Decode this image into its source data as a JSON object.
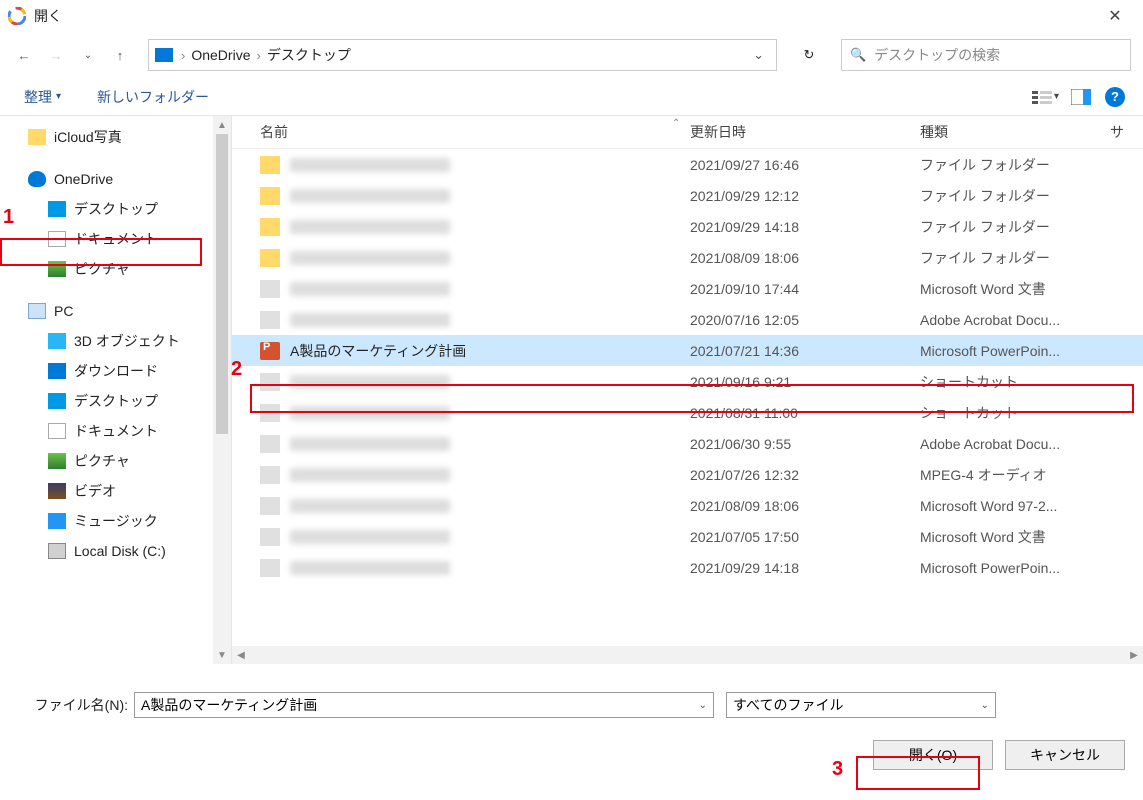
{
  "window": {
    "title": "開く"
  },
  "nav": {
    "breadcrumb": [
      "OneDrive",
      "デスクトップ"
    ]
  },
  "search": {
    "placeholder": "デスクトップの検索"
  },
  "toolbar": {
    "organize": "整理",
    "new_folder": "新しいフォルダー"
  },
  "sidebar": {
    "items": [
      {
        "label": "iCloud写真",
        "icon": "ic-folder",
        "indent": 0
      },
      {
        "label": "OneDrive",
        "icon": "ic-cloud",
        "indent": 0,
        "space_before": true
      },
      {
        "label": "デスクトップ",
        "icon": "ic-monitor",
        "indent": 1,
        "highlighted": true
      },
      {
        "label": "ドキュメント",
        "icon": "ic-doc",
        "indent": 1
      },
      {
        "label": "ピクチャ",
        "icon": "ic-pic",
        "indent": 1
      },
      {
        "label": "PC",
        "icon": "ic-pc",
        "indent": 0,
        "space_before": true
      },
      {
        "label": "3D オブジェクト",
        "icon": "ic-cube",
        "indent": 1
      },
      {
        "label": "ダウンロード",
        "icon": "ic-dl",
        "indent": 1
      },
      {
        "label": "デスクトップ",
        "icon": "ic-monitor",
        "indent": 1
      },
      {
        "label": "ドキュメント",
        "icon": "ic-doc",
        "indent": 1
      },
      {
        "label": "ピクチャ",
        "icon": "ic-pic",
        "indent": 1
      },
      {
        "label": "ビデオ",
        "icon": "ic-vid",
        "indent": 1
      },
      {
        "label": "ミュージック",
        "icon": "ic-music",
        "indent": 1
      },
      {
        "label": "Local Disk (C:)",
        "icon": "ic-disk",
        "indent": 1
      }
    ]
  },
  "list": {
    "headers": {
      "name": "名前",
      "date": "更新日時",
      "type": "種類",
      "size": "サ"
    },
    "rows": [
      {
        "name": "",
        "date": "2021/09/27 16:46",
        "type": "ファイル フォルダー"
      },
      {
        "name": "",
        "date": "2021/09/29 12:12",
        "type": "ファイル フォルダー"
      },
      {
        "name": "",
        "date": "2021/09/29 14:18",
        "type": "ファイル フォルダー"
      },
      {
        "name": "",
        "date": "2021/08/09 18:06",
        "type": "ファイル フォルダー"
      },
      {
        "name": "",
        "date": "2021/09/10 17:44",
        "type": "Microsoft Word 文書"
      },
      {
        "name": "",
        "date": "2020/07/16 12:05",
        "type": "Adobe Acrobat Docu..."
      },
      {
        "name": "A製品のマーケティング計画",
        "date": "2021/07/21 14:36",
        "type": "Microsoft PowerPoin...",
        "icon": "ic-ppt",
        "selected": true
      },
      {
        "name": "",
        "date": "2021/09/16 9:21",
        "type": "ショートカット"
      },
      {
        "name": "",
        "date": "2021/08/31 11:00",
        "type": "ショートカット"
      },
      {
        "name": "",
        "date": "2021/06/30 9:55",
        "type": "Adobe Acrobat Docu..."
      },
      {
        "name": "",
        "date": "2021/07/26 12:32",
        "type": "MPEG-4 オーディオ"
      },
      {
        "name": "",
        "date": "2021/08/09 18:06",
        "type": "Microsoft Word 97-2..."
      },
      {
        "name": "",
        "date": "2021/07/05 17:50",
        "type": "Microsoft Word 文書"
      },
      {
        "name": "",
        "date": "2021/09/29 14:18",
        "type": "Microsoft PowerPoin..."
      }
    ]
  },
  "footer": {
    "filename_label": "ファイル名(N):",
    "filename_value": "A製品のマーケティング計画",
    "filetype_value": "すべてのファイル",
    "open": "開く(O)",
    "cancel": "キャンセル"
  },
  "annotations": {
    "a1": "1",
    "a2": "2",
    "a3": "3"
  }
}
